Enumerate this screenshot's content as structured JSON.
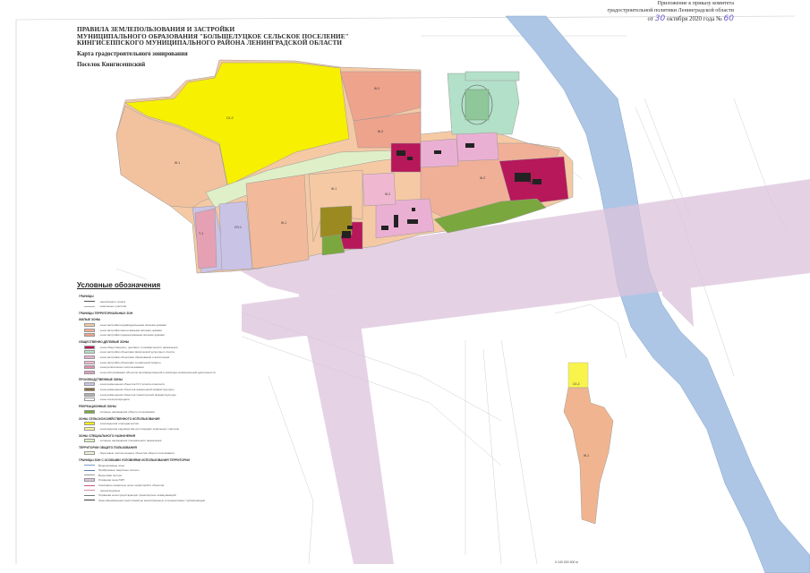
{
  "corner": {
    "line1": "Приложение к приказу комитета",
    "line2": "градостроительной политики Ленинградской области",
    "date_prefix": "от",
    "date_day": "30",
    "date_rest": "октября 2020 года №",
    "number": "60"
  },
  "title": {
    "line1": "ПРАВИЛА ЗЕМЛЕПОЛЬЗОВАНИЯ И ЗАСТРОЙКИ",
    "line2": "МУНИЦИПАЛЬНОГО ОБРАЗОВАНИЯ \"БОЛЬШЕЛУЦКОЕ СЕЛЬСКОЕ ПОСЕЛЕНИЕ\"",
    "line3": "КИНГИСЕППСКОГО МУНИЦИПАЛЬНОГО РАЙОНА ЛЕНИНГРАДСКОЙ ОБЛАСТИ",
    "map_name": "Карта градостроительного зонирования",
    "settlement": "Поселок Кингисеппский"
  },
  "colors": {
    "river": "#a9c4e4",
    "corridor": "#dcc4dc",
    "residential_low": "#f5c9a4",
    "agri": "#f7f000",
    "public_dark": "#b7185a",
    "public_pink": "#eab0d3",
    "sport": "#b3e0c8",
    "green": "#7aa83e",
    "olive": "#9b8a20",
    "industrial": "#c9c3e6",
    "light_green": "#dff0c8",
    "salmon": "#eea38d"
  },
  "zone_labels": {
    "zh1_a": "Ж-1",
    "zh1_b": "Ж-1",
    "zh1_c": "Ж-1",
    "zh1_d": "Ж-1",
    "zh1_e": "Ж-1",
    "zh2_a": "Ж-2",
    "zh2_b": "Ж-2",
    "zh2_c": "Ж-2",
    "zh2_d": "Ж-2",
    "sh2_a": "СХ-2",
    "sh2_b": "СХ-2",
    "od1": "ОД-1",
    "od2": "ОД-2",
    "r1": "Р-1",
    "sp1": "СП-1",
    "tr1": "Т-1",
    "s1": "Сл-1"
  },
  "legend": {
    "title": "Условные обозначения",
    "h_bounds": "ГРАНИЦЫ",
    "b1": "- населённого пункта",
    "b2": "- земельных участков",
    "h_zones": "ГРАНИЦЫ ТЕРРИТОРИАЛЬНЫХ ЗОН",
    "h_res": "ЖИЛЫЕ ЗОНЫ",
    "r1": "- зона застройки индивидуальными жилыми домами",
    "r2": "- зона застройки малоэтажными жилыми домами",
    "r3": "- зона застройки среднеэтажными жилыми домами",
    "h_pub": "ОБЩЕСТВЕННО-ДЕЛОВЫЕ ЗОНЫ",
    "p1": "- зона общественного, делового и коммерческого назначения",
    "p2": "- зона застройки объектами физической культуры и спорта",
    "p3": "- зона застройки объектами образования и воспитания",
    "p4": "- зона застройки объектами социальной защиты",
    "p5": "- зона религиозного использования",
    "p6": "- зона обслуживания объектов производственной и жилищно-коммунальной деятельности",
    "h_prod": "ПРОИЗВОДСТВЕННЫЕ ЗОНЫ",
    "i1": "- зона размещения объектов IV-V класса опасности",
    "i2": "- зона размещения объектов инженерной инфраструктуры",
    "i3": "- зона размещения объектов транспортной инфраструктуры",
    "i4": "- зоны электропередачи",
    "h_rec": "РЕКРЕАЦИОННЫЕ ЗОНЫ",
    "c1": "- зеленые насаждения общего пользования",
    "h_agri": "ЗОНЫ СЕЛЬСКОХОЗЯЙСТВЕННОГО ИСПОЛЬЗОВАНИЯ",
    "a1": "- зона ведения огородничества",
    "a2": "- зона ведения садоводства на площадях земельных участков",
    "h_spec": "ЗОНЫ СПЕЦИАЛЬНОГО НАЗНАЧЕНИЯ",
    "s1": "- зеленые насаждения специального назначения",
    "h_terr": "ТЕРРИТОРИИ ОБЩЕГО ПОЛЬЗОВАНИЯ",
    "t1": "- береговые полосы водных объектов общего пользования",
    "h_zouit": "ГРАНИЦЫ ЗОН С ОСОБЫМИ УСЛОВИЯМИ ИСПОЛЬЗОВАНИЯ ТЕРРИТОРИИ",
    "z1": "Водоохранные зоны",
    "z2": "Прибрежные защитные полосы",
    "z3": "Береговая полоса",
    "z4": "Охранная зона ЛЭП",
    "z5": "Санитарно-защитные зоны территорий и объектов",
    "z6": "- проектируемые",
    "z7": "Охранная зона существующих транспортных коммуникаций",
    "z8": "Зоны минимальных расстояний до магистральных и промысловых трубопроводов"
  },
  "scale_text": "0   100   200  300 м"
}
